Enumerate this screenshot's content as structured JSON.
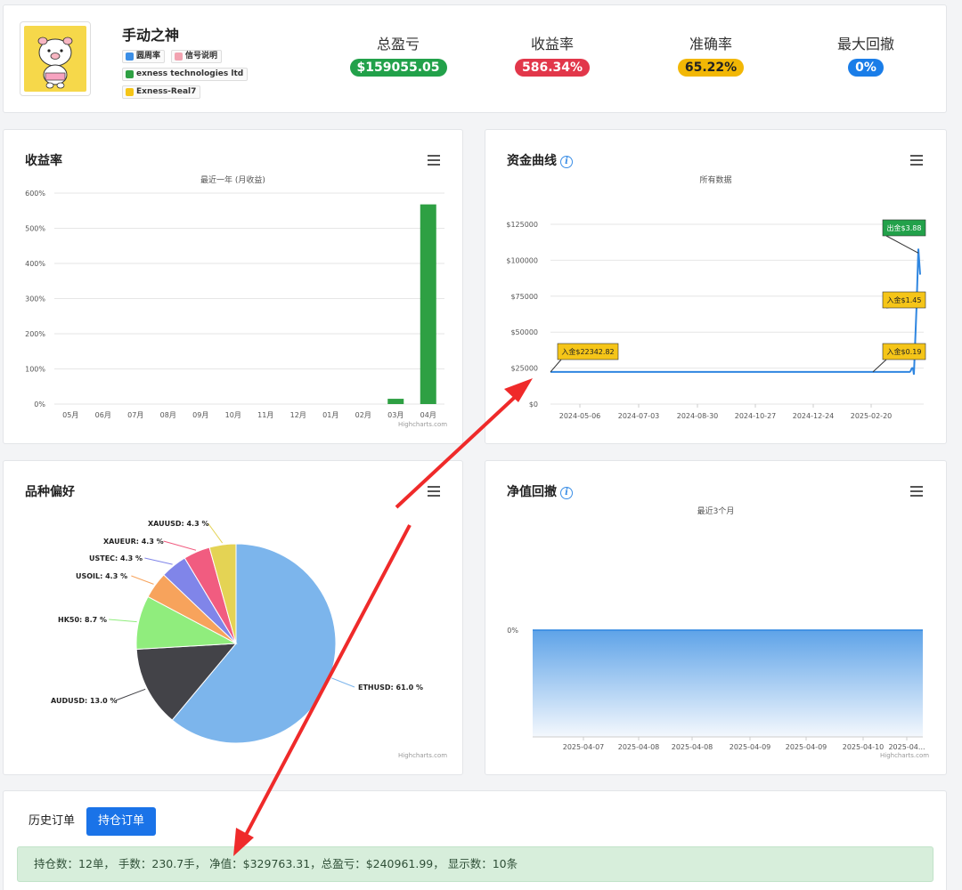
{
  "header": {
    "name": "手动之神",
    "tags": [
      "圆周率",
      "信号说明",
      "exness technologies ltd",
      "Exness-Real7"
    ],
    "stats": [
      {
        "label": "总盈亏",
        "value": "$159055.05",
        "color": "#22a14a"
      },
      {
        "label": "收益率",
        "value": "586.34%",
        "color": "#e2374a"
      },
      {
        "label": "准确率",
        "value": "65.22%",
        "color": "#f2b705"
      },
      {
        "label": "最大回撤",
        "value": "0%",
        "color": "#1a7de8"
      }
    ]
  },
  "returns_panel": {
    "title": "收益率",
    "subtitle": "最近一年 (月收益)",
    "credit": "Highcharts.com"
  },
  "equity_panel": {
    "title": "资金曲线",
    "subtitle": "所有数据",
    "credit": "Highcharts.com"
  },
  "symbol_panel": {
    "title": "品种偏好",
    "credit": "Highcharts.com"
  },
  "drawdown_panel": {
    "title": "净值回撤",
    "subtitle": "最近3个月",
    "credit": "Highcharts.com"
  },
  "orders": {
    "tab_history": "历史订单",
    "tab_open": "持仓订单",
    "summary": "持仓数：12单，  手数：230.7手，  净值：$329763.31，总盈亏：$240961.99，  显示数：10条"
  },
  "chart_data": [
    {
      "type": "bar",
      "title": "收益率",
      "subtitle": "最近一年 (月收益)",
      "categories": [
        "05月",
        "06月",
        "07月",
        "08月",
        "09月",
        "10月",
        "11月",
        "12月",
        "01月",
        "02月",
        "03月",
        "04月"
      ],
      "values": [
        0,
        0,
        0,
        0,
        0,
        0,
        0,
        0,
        0,
        0,
        15,
        568
      ],
      "ylim": [
        0,
        600
      ],
      "yticks": [
        "0%",
        "100%",
        "200%",
        "300%",
        "400%",
        "500%",
        "600%"
      ],
      "color": "#2ea043"
    },
    {
      "type": "line",
      "title": "资金曲线",
      "subtitle": "所有数据",
      "x_labels": [
        "2024-05-06",
        "2024-07-03",
        "2024-08-30",
        "2024-10-27",
        "2024-12-24",
        "2025-02-20"
      ],
      "yticks": [
        "$0",
        "$25000",
        "$50000",
        "$75000",
        "$100000",
        "$125000"
      ],
      "ylim": [
        0,
        125000
      ],
      "color": "#2f86e0",
      "annotations": [
        {
          "text": "入金$22342.82",
          "color": "#f5c518"
        },
        {
          "text": "入金$0.19",
          "color": "#f5c518"
        },
        {
          "text": "入金$1.45",
          "color": "#f5c518"
        },
        {
          "text": "出金$3.88",
          "color": "#22a14a"
        }
      ]
    },
    {
      "type": "pie",
      "title": "品种偏好",
      "slices": [
        {
          "name": "ETHUSD: 61.0 %",
          "value": 61.0,
          "color": "#7cb5ec"
        },
        {
          "name": "AUDUSD: 13.0 %",
          "value": 13.0,
          "color": "#434348"
        },
        {
          "name": "HK50: 8.7 %",
          "value": 8.7,
          "color": "#90ed7d"
        },
        {
          "name": "USOIL: 4.3 %",
          "value": 4.3,
          "color": "#f7a35c"
        },
        {
          "name": "USTEC: 4.3 %",
          "value": 4.3,
          "color": "#8085e9"
        },
        {
          "name": "XAUEUR: 4.3 %",
          "value": 4.3,
          "color": "#f15c80"
        },
        {
          "name": "XAUUSD: 4.3 %",
          "value": 4.3,
          "color": "#e4d354"
        }
      ]
    },
    {
      "type": "area",
      "title": "净值回撤",
      "subtitle": "最近3个月",
      "x_labels": [
        "2025-04-07",
        "2025-04-08",
        "2025-04-08",
        "2025-04-09",
        "2025-04-09",
        "2025-04-10",
        "2025-04..."
      ],
      "yticks": [
        "0%"
      ],
      "values": [
        0,
        0,
        0,
        0,
        0,
        0,
        0
      ],
      "color": "#2f86e0"
    }
  ]
}
